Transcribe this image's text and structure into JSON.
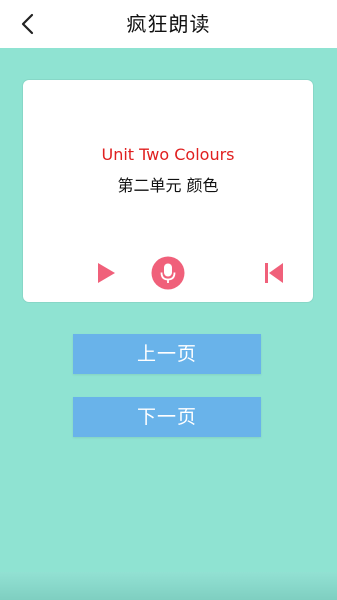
{
  "header": {
    "title": "疯狂朗读",
    "back_icon": "chevron-left-icon"
  },
  "card": {
    "english": "Unit Two Colours",
    "chinese": "第二单元 颜色",
    "controls": [
      "play-icon",
      "microphone-icon",
      "skip-previous-icon"
    ]
  },
  "buttons": {
    "prev_page": "上一页",
    "next_page": "下一页"
  },
  "colors": {
    "background": "#8fe3d2",
    "accent_icon": "#f0607a",
    "button": "#69b3ea",
    "english_text": "#e02020"
  }
}
